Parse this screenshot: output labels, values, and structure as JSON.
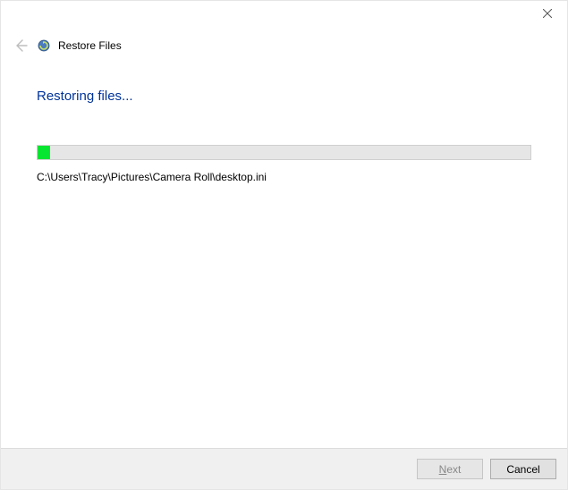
{
  "window": {
    "title": "Restore Files"
  },
  "content": {
    "heading": "Restoring files...",
    "progress_percent": 2.5,
    "current_path": "C:\\Users\\Tracy\\Pictures\\Camera Roll\\desktop.ini"
  },
  "footer": {
    "next_label_prefix": "N",
    "next_label_suffix": "ext",
    "cancel_label": "Cancel"
  }
}
